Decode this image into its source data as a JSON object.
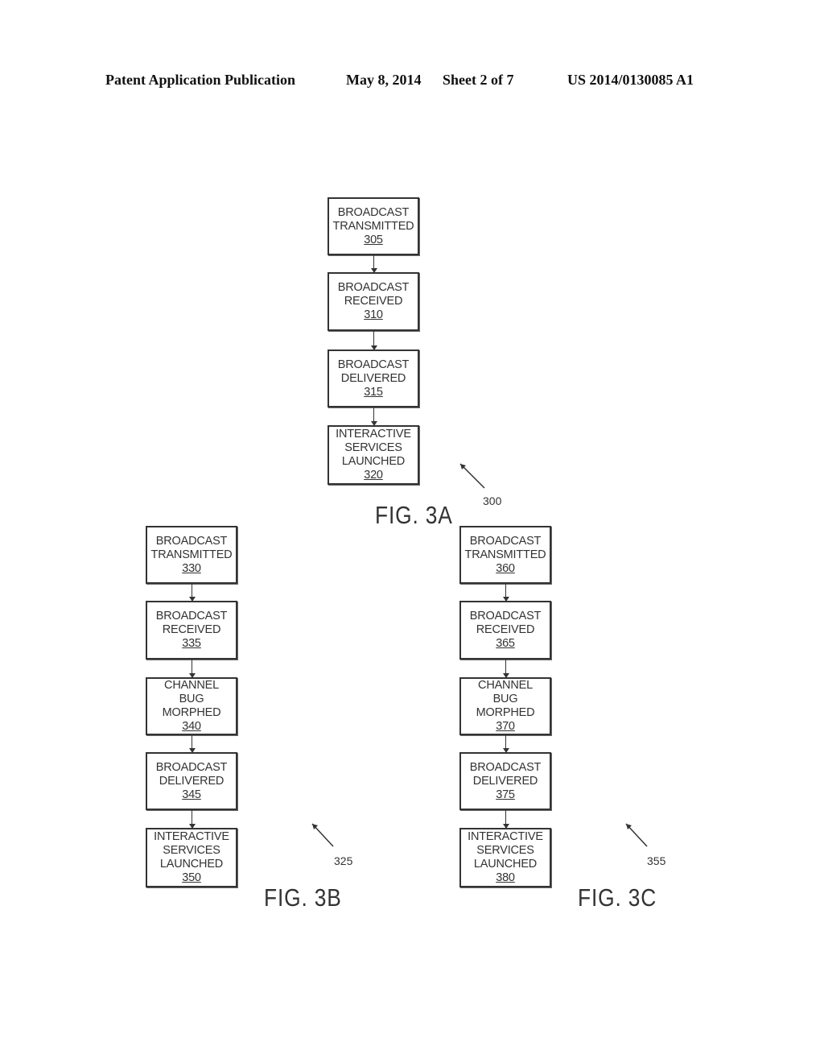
{
  "header": {
    "publication": "Patent Application Publication",
    "date": "May 8, 2014",
    "sheet": "Sheet 2 of 7",
    "number": "US 2014/0130085 A1"
  },
  "figures": [
    {
      "id": "3A",
      "label": "FIG. 3A",
      "ref": "300",
      "steps": [
        {
          "lines": [
            "BROADCAST",
            "TRANSMITTED"
          ],
          "ref": "305"
        },
        {
          "lines": [
            "BROADCAST",
            "RECEIVED"
          ],
          "ref": "310"
        },
        {
          "lines": [
            "BROADCAST",
            "DELIVERED"
          ],
          "ref": "315"
        },
        {
          "lines": [
            "INTERACTIVE",
            "SERVICES",
            "LAUNCHED"
          ],
          "ref": "320"
        }
      ]
    },
    {
      "id": "3B",
      "label": "FIG. 3B",
      "ref": "325",
      "steps": [
        {
          "lines": [
            "BROADCAST",
            "TRANSMITTED"
          ],
          "ref": "330"
        },
        {
          "lines": [
            "BROADCAST",
            "RECEIVED"
          ],
          "ref": "335"
        },
        {
          "lines": [
            "CHANNEL",
            "BUG",
            "MORPHED"
          ],
          "ref": "340"
        },
        {
          "lines": [
            "BROADCAST",
            "DELIVERED"
          ],
          "ref": "345"
        },
        {
          "lines": [
            "INTERACTIVE",
            "SERVICES",
            "LAUNCHED"
          ],
          "ref": "350"
        }
      ]
    },
    {
      "id": "3C",
      "label": "FIG. 3C",
      "ref": "355",
      "steps": [
        {
          "lines": [
            "BROADCAST",
            "TRANSMITTED"
          ],
          "ref": "360"
        },
        {
          "lines": [
            "BROADCAST",
            "RECEIVED"
          ],
          "ref": "365"
        },
        {
          "lines": [
            "CHANNEL",
            "BUG",
            "MORPHED"
          ],
          "ref": "370"
        },
        {
          "lines": [
            "BROADCAST",
            "DELIVERED"
          ],
          "ref": "375"
        },
        {
          "lines": [
            "INTERACTIVE",
            "SERVICES",
            "LAUNCHED"
          ],
          "ref": "380"
        }
      ]
    }
  ]
}
